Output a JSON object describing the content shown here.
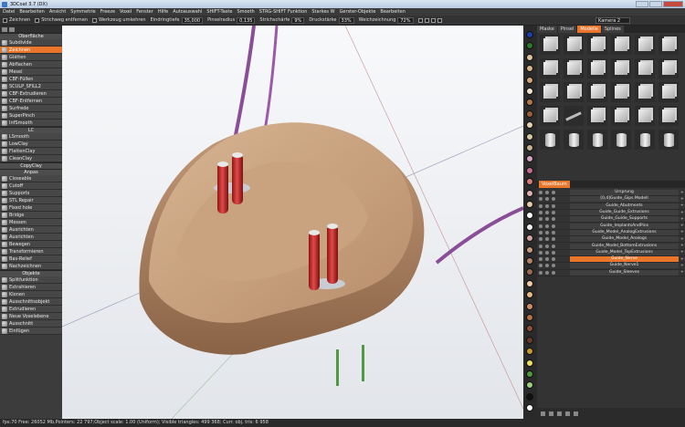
{
  "window": {
    "title": "3DCoat 3.7 (DX)"
  },
  "menu": [
    "Datei",
    "Bearbeiten",
    "Ansicht",
    "Symmetrie",
    "Freeze",
    "Voxel",
    "Fenster",
    "Hilfe",
    "Autoauswahl",
    "SHIFT-Taste",
    "Smooth",
    "STRG-SHIFT Funktion",
    "Starkes W",
    "Gerster-Objekte",
    "Bearbeiten"
  ],
  "toolbar": {
    "draw_label": "Zeichnen",
    "remove_stroke_label": "Strichweg entfernen",
    "tool_reverse_label": "Werkzeug umkehren",
    "depth_label": "Eindringtiefe",
    "depth_value": "35,000",
    "radius_label": "Pinselradius",
    "radius_value": "0,135",
    "edge_label": "Strichschärfe",
    "edge_value": "9%",
    "pressure_label": "Druckstärke",
    "pressure_value": "33%",
    "smoothing_label": "Weichzeichnung",
    "smoothing_value": "72%",
    "camera_select": "Kamera 2"
  },
  "left_panel": {
    "sections": [
      {
        "header": "Oberfläche",
        "items": [
          "Subdivide",
          "Zeichnen",
          "Glätten",
          "Abflachen",
          "Mesel",
          "CBF-Füllen",
          "SCULP_SFILL2",
          "CBF-Extrudieren",
          "CBF-Entfernen",
          "Surfrede",
          "SuperPinch",
          "InfSmooth"
        ]
      },
      {
        "header": "LC",
        "items": [
          "LSmooth",
          "LowClay",
          "FlattenClay",
          "CleanClay"
        ]
      },
      {
        "header": "CopyClay",
        "items": []
      },
      {
        "header": "Anpas",
        "items": [
          "Closeable",
          "Cutoff",
          "Supports",
          "STL Repair",
          "Fixed hole",
          "Bridge",
          "Messen",
          "Ausrichten",
          "Ausrichten",
          "Bewegen",
          "Transformieren",
          "Bas-Relief",
          "Nachzeichnen"
        ]
      },
      {
        "header": "Objekte",
        "items": [
          "Splitfunktion",
          "Extrahieren",
          "Klonen",
          "Ausschnittsobjekt",
          "Extrudieren",
          "Neue Voxelebene",
          "Ausschnitt",
          "Einfügen"
        ]
      }
    ],
    "active_item": "Zeichnen"
  },
  "viewport": {
    "background": "#eef0f3"
  },
  "colors": {
    "accent": "#e9762b",
    "swatches": [
      "#1a3fb0",
      "#2b7a2b",
      "#e3c39a",
      "#d9b38a",
      "#cfa57a",
      "#f4e3cf",
      "#b37747",
      "#9b5d39",
      "#e5d2ae",
      "#d8c8a0",
      "#c7b28f",
      "#d4a0c4",
      "#c46a8e",
      "#d67b7b",
      "#e0b0b0",
      "#e8cba8",
      "#ffffff",
      "#f0f0f0",
      "#d4a5a5",
      "#c79b7a",
      "#b58163",
      "#9c6a4f",
      "#f2cda0",
      "#e8b983",
      "#cf8f63",
      "#b7724a",
      "#8e5137",
      "#6b3b28",
      "#cc9a2a",
      "#f1e05a",
      "#4e9a3c",
      "#9ad17a",
      "#101010",
      "#ffffff"
    ]
  },
  "right_panel": {
    "tabs": [
      "Maske",
      "Pinsel",
      "Modelle",
      "Splines"
    ],
    "active_tab": "Modelle",
    "primitives": [
      "cube",
      "cube",
      "cube",
      "cube",
      "cube",
      "cube",
      "cube",
      "cube",
      "cube",
      "cube",
      "cube",
      "cube",
      "cube",
      "cube",
      "cube",
      "cube",
      "cube",
      "cube",
      "cube",
      "rod",
      "cube",
      "cube",
      "cube",
      "cube",
      "cyl",
      "cyl",
      "cyl",
      "cyl",
      "cyl",
      "cyl"
    ],
    "voxtree_label": "VoxelBaum",
    "tree": [
      {
        "name": "Ursprung",
        "active": false
      },
      {
        "name": "[0,4]Guide_Gips Modell",
        "active": false
      },
      {
        "name": "Guide_Abutments",
        "active": false
      },
      {
        "name": "Guide_Guide_Extrusions",
        "active": false
      },
      {
        "name": "Guide_Guide_Supports",
        "active": false
      },
      {
        "name": "Guide_ImplantsAndPins",
        "active": false
      },
      {
        "name": "Guide_Model_AnalogExtrusions",
        "active": false
      },
      {
        "name": "Guide_Model_Analogs",
        "active": false
      },
      {
        "name": "Guide_Model_BottomExtrusions",
        "active": false
      },
      {
        "name": "Guide_Model_TopExtrusions",
        "active": false
      },
      {
        "name": "Guide_Nerve",
        "active": true
      },
      {
        "name": "Guide_Nerve1",
        "active": false
      },
      {
        "name": "Guide_Sleeves",
        "active": false
      }
    ]
  },
  "status": {
    "text": "fps:70   Free: 26052 Mb,Pointers: 22 797;Object scale: 1.00 (Uniform); Visible triangles: 499 368; Curr. obj. tris: 6 958"
  }
}
